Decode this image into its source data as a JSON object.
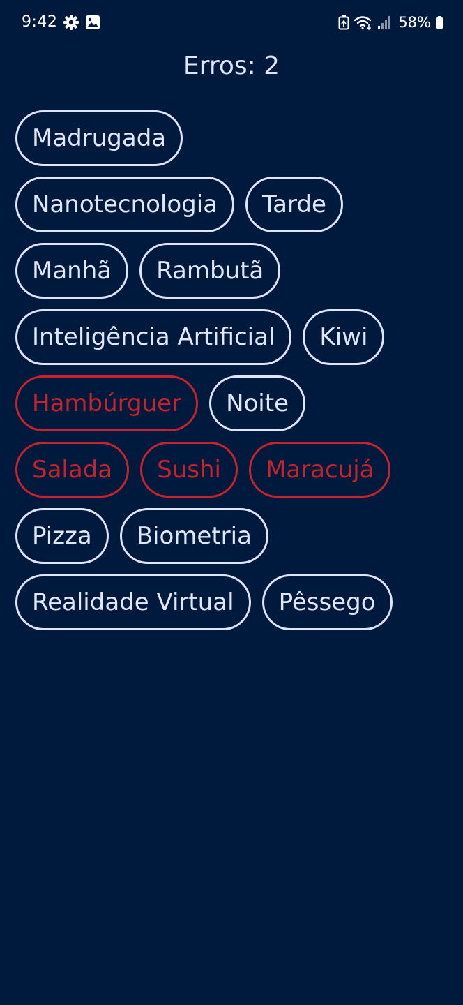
{
  "status_bar": {
    "time": "9:42",
    "battery": "58%",
    "left_icons": [
      "settings-icon",
      "image-icon"
    ],
    "right_icons": [
      "battery-saver-icon",
      "wifi-icon",
      "signal-icon",
      "battery-icon"
    ]
  },
  "header": {
    "errors_label": "Erros: 2"
  },
  "colors": {
    "background": "#001a3d",
    "chip_default": "#e1e7fb",
    "chip_wrong": "#c8232c"
  },
  "rows": [
    {
      "chips": [
        {
          "label": "Madrugada",
          "state": "default"
        }
      ]
    },
    {
      "chips": [
        {
          "label": "Nanotecnologia",
          "state": "default"
        },
        {
          "label": "Tarde",
          "state": "default"
        }
      ]
    },
    {
      "chips": [
        {
          "label": "Manhã",
          "state": "default"
        },
        {
          "label": "Rambutã",
          "state": "default"
        }
      ]
    },
    {
      "chips": [
        {
          "label": "Inteligência Artificial",
          "state": "default"
        },
        {
          "label": "Kiwi",
          "state": "default"
        }
      ]
    },
    {
      "chips": [
        {
          "label": "Hambúrguer",
          "state": "wrong"
        },
        {
          "label": "Noite",
          "state": "default"
        }
      ]
    },
    {
      "chips": [
        {
          "label": "Salada",
          "state": "wrong"
        },
        {
          "label": "Sushi",
          "state": "wrong"
        },
        {
          "label": "Maracujá",
          "state": "wrong"
        }
      ]
    },
    {
      "chips": [
        {
          "label": "Pizza",
          "state": "default"
        },
        {
          "label": "Biometria",
          "state": "default"
        }
      ]
    },
    {
      "chips": [
        {
          "label": "Realidade Virtual",
          "state": "default"
        },
        {
          "label": "Pêssego",
          "state": "default"
        }
      ]
    }
  ]
}
